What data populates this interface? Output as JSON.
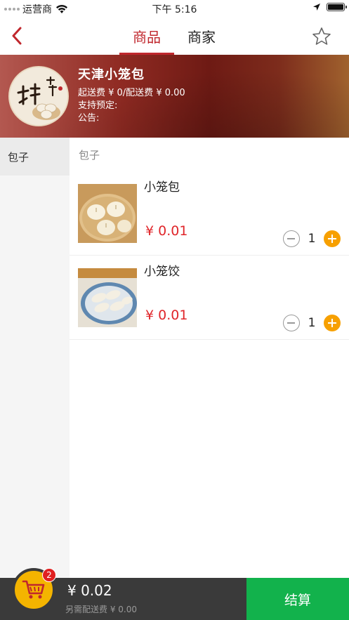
{
  "status_bar": {
    "carrier": "运营商",
    "time": "下午 5:16"
  },
  "nav": {
    "tabs": [
      {
        "label": "商品",
        "active": true
      },
      {
        "label": "商家",
        "active": false
      }
    ],
    "back_icon": "chevron-left-icon",
    "favorite_icon": "star-outline-icon"
  },
  "shop": {
    "name": "天津小笼包",
    "delivery_line": "起送费 ¥ 0/配送费 ¥ 0.00",
    "preorder_line": "支持预定:",
    "notice_line": "公告:",
    "logo_text": "天津小笼包"
  },
  "categories": [
    {
      "label": "包子",
      "selected": true
    }
  ],
  "section_title": "包子",
  "products": [
    {
      "name": "小笼包",
      "price": "¥ 0.01",
      "quantity": "1"
    },
    {
      "name": "小笼饺",
      "price": "¥ 0.01",
      "quantity": "1"
    }
  ],
  "cart": {
    "badge_count": "2",
    "total": "¥ 0.02",
    "delivery_note": "另需配送费 ¥ 0.00",
    "checkout_label": "结算"
  },
  "colors": {
    "accent_red": "#c0272d",
    "price_red": "#e0262a",
    "checkout_green": "#12b24c",
    "plus_orange": "#f7a000",
    "cart_yellow": "#f4b400"
  }
}
